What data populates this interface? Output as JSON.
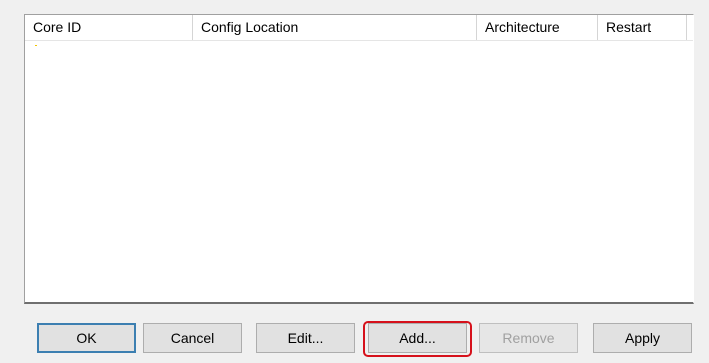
{
  "list": {
    "columns": [
      {
        "label": "Core ID"
      },
      {
        "label": "Config Location"
      },
      {
        "label": "Architecture"
      },
      {
        "label": "Restart"
      }
    ],
    "rows": []
  },
  "buttons": {
    "ok": "OK",
    "cancel": "Cancel",
    "edit": "Edit...",
    "add": "Add...",
    "remove": "Remove",
    "apply": "Apply"
  },
  "colors": {
    "highlight": "#d6111b",
    "background": "#f0f0f0"
  }
}
